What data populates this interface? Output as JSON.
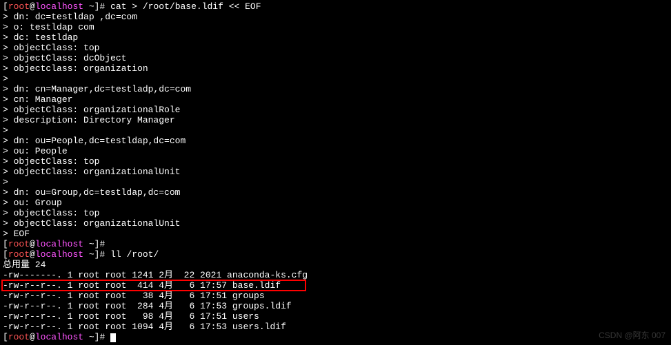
{
  "prompt": {
    "openBracket": "[",
    "user": "root",
    "at": "@",
    "host": "localhost",
    "tilde": " ~",
    "closeBracket": "]# "
  },
  "lines": {
    "cmd1": "cat > /root/base.ldif << EOF",
    "l1": "> dn: dc=testldap ,dc=com",
    "l2": "> o: testldap com",
    "l3": "> dc: testldap",
    "l4": "> objectClass: top",
    "l5": "> objectClass: dcObject",
    "l6": "> objectclass: organization",
    "l7": "> ",
    "l8": "> dn: cn=Manager,dc=testladp,dc=com",
    "l9": "> cn: Manager",
    "l10": "> objectClass: organizationalRole",
    "l11": "> description: Directory Manager",
    "l12": "> ",
    "l13": "> dn: ou=People,dc=testldap,dc=com",
    "l14": "> ou: People",
    "l15": "> objectClass: top",
    "l16": "> objectClass: organizationalUnit",
    "l17": "> ",
    "l18": "> dn: ou=Group,dc=testldap,dc=com",
    "l19": "> ou: Group",
    "l20": "> objectClass: top",
    "l21": "> objectClass: organizationalUnit",
    "l22": "> EOF",
    "cmd2": "",
    "cmd3": "ll /root/",
    "total": "总用量 24",
    "f1": "-rw-------. 1 root root 1241 2月  22 2021 anaconda-ks.cfg",
    "f2": "-rw-r--r--. 1 root root  414 4月   6 17:57 base.ldif",
    "f3": "-rw-r--r--. 1 root root   38 4月   6 17:51 groups",
    "f4": "-rw-r--r--. 1 root root  284 4月   6 17:53 groups.ldif",
    "f5": "-rw-r--r--. 1 root root   98 4月   6 17:51 users",
    "f6": "-rw-r--r--. 1 root root 1094 4月   6 17:53 users.ldif"
  },
  "watermark": "CSDN @阿东 007"
}
